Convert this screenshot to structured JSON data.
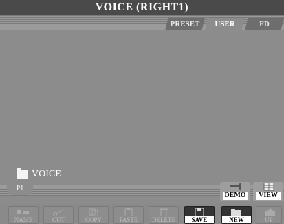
{
  "title": "VOICE (RIGHT1)",
  "tabs": [
    {
      "label": "PRESET"
    },
    {
      "label": "USER"
    },
    {
      "label": "FD"
    }
  ],
  "folder": {
    "label": "VOICE"
  },
  "page_tab": {
    "label": "P1"
  },
  "side_buttons": [
    {
      "label": "DEMO"
    },
    {
      "label": "VIEW"
    }
  ],
  "function_buttons": [
    {
      "label": "NAME"
    },
    {
      "label": "CUT"
    },
    {
      "label": "COPY"
    },
    {
      "label": "PASTE"
    },
    {
      "label": "DELETE"
    },
    {
      "label": "SAVE"
    },
    {
      "label": "NEW"
    },
    {
      "label": "UP"
    }
  ],
  "icons": {
    "folder": "folder-icon",
    "demo": "trumpet-icon",
    "view": "grid-view-icon",
    "name": "abc-label-icon",
    "cut": "scissors-icon",
    "copy": "copy-icon",
    "paste": "paste-icon",
    "delete": "trash-icon",
    "save": "floppy-disk-icon",
    "new": "new-folder-icon",
    "up": "folder-up-icon"
  }
}
